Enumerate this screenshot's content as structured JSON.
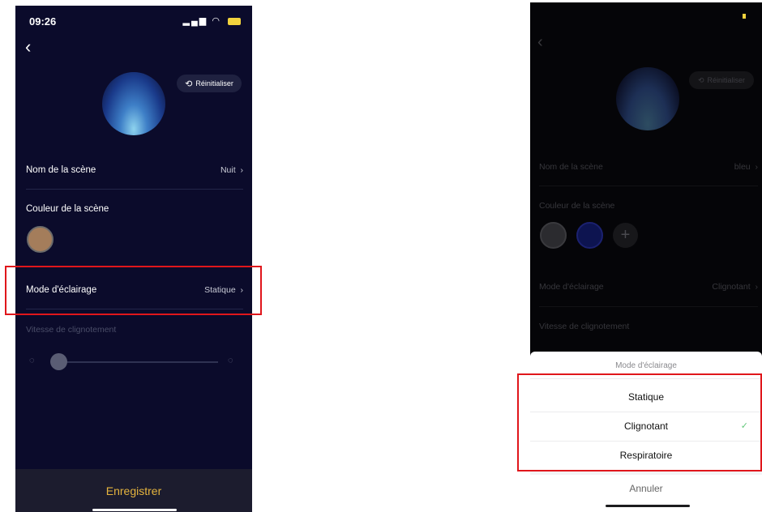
{
  "left_screen": {
    "status": {
      "time": "09:26",
      "location_icon": "location-arrow-icon",
      "signal_icon": "signal-icon",
      "wifi_icon": "wifi-icon",
      "battery_icon": "battery-charging-icon"
    },
    "back_icon": "chevron-left-icon",
    "reset_button": {
      "icon": "refresh-icon",
      "label": "Réinitialiser"
    },
    "scene_name": {
      "label": "Nom de la scène",
      "value": "Nuit"
    },
    "scene_color": {
      "label": "Couleur de la scène",
      "swatch": "#a47d5b"
    },
    "lighting_mode": {
      "label": "Mode d'éclairage",
      "value": "Statique"
    },
    "blink_speed": {
      "label": "Vitesse de clignotement",
      "slow_icon": "slow-speed-icon",
      "fast_icon": "fast-speed-icon"
    },
    "save_button": {
      "label": "Enregistrer"
    },
    "colors": {
      "background": "#0b0b2b",
      "accent": "#e5b43e"
    }
  },
  "right_screen": {
    "back_icon": "chevron-left-icon",
    "reset_button": {
      "icon": "refresh-icon",
      "label": "Réinitialiser"
    },
    "scene_name": {
      "label": "Nom de la scène",
      "value": "bleu"
    },
    "scene_color": {
      "label": "Couleur de la scène",
      "swatches": [
        "#2b2b2f",
        "#0d1450"
      ],
      "add_label": "+"
    },
    "lighting_mode": {
      "label": "Mode d'éclairage",
      "value": "Clignotant"
    },
    "blink_speed": {
      "label": "Vitesse de clignotement"
    },
    "action_sheet": {
      "title": "Mode d'éclairage",
      "options": [
        {
          "label": "Statique",
          "selected": false
        },
        {
          "label": "Clignotant",
          "selected": true
        },
        {
          "label": "Respiratoire",
          "selected": false
        }
      ],
      "check_icon": "checkmark-icon",
      "cancel_label": "Annuler"
    }
  },
  "annotation_color": "#e0161b"
}
